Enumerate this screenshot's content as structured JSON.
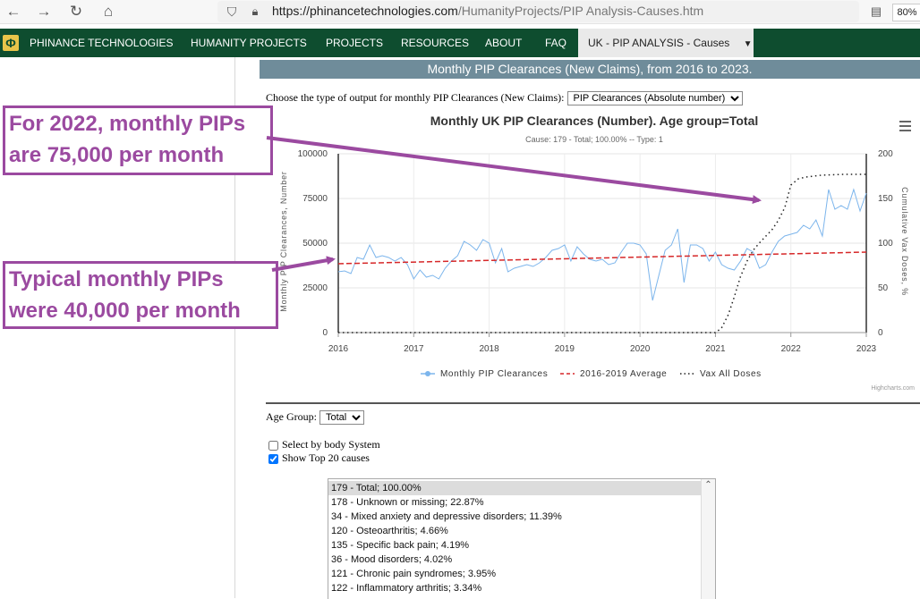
{
  "browser": {
    "url_host": "https://phinancetechnologies.com",
    "url_path": "/HumanityProjects/PIP Analysis-Causes.htm",
    "zoom": "80%"
  },
  "site_nav": {
    "logo": "Φ",
    "items": [
      "PHINANCE TECHNOLOGIES",
      "HUMANITY PROJECTS",
      "PROJECTS",
      "RESOURCES",
      "ABOUT",
      "FAQ"
    ],
    "active": "UK - PIP ANALYSIS - Causes"
  },
  "page": {
    "banner": "Monthly PIP Clearances (New Claims), from 2016 to 2023.",
    "output_label": "Choose the type of output for monthly PIP Clearances (New Claims):",
    "output_selected": "PIP Clearances (Absolute number)",
    "age_label": "Age Group:",
    "age_selected": "Total",
    "check_body": "Select by body System",
    "check_top20": "Show Top 20 causes",
    "causes": [
      "179 - Total; 100.00%",
      "178 - Unknown or missing; 22.87%",
      "34 - Mixed anxiety and depressive disorders; 11.39%",
      "120 - Osteoarthritis; 4.66%",
      "135 - Specific back pain; 4.19%",
      "36 - Mood disorders; 4.02%",
      "121 - Chronic pain syndromes; 3.95%",
      "122 - Inflammatory arthritis; 3.34%"
    ]
  },
  "annotations": {
    "callout_top_line1": "For 2022, monthly PIPs",
    "callout_top_line2": "are 75,000 per month",
    "callout_bottom_line1": "Typical monthly PIPs",
    "callout_bottom_line2": "were 40,000 per month"
  },
  "colors": {
    "nav": "#0e4d2f",
    "banner": "#6f8c9a",
    "callout": "#9b4aa0",
    "series": "#7cb5ec",
    "avg": "#d62728"
  },
  "chart_data": {
    "type": "line",
    "title": "Monthly UK PIP Clearances (Number). Age group=Total",
    "subtitle": "Cause: 179 - Total; 100.00% -- Type: 1",
    "ylabel": "Monthly PIP Clearances, Number",
    "y2label": "Cumulative Vax Doses, %",
    "credit": "Highcharts.com",
    "ylim": [
      0,
      100000
    ],
    "y2lim": [
      0,
      200
    ],
    "y_ticks": [
      "0",
      "25000",
      "50000",
      "75000",
      "100000"
    ],
    "y2_ticks": [
      "0",
      "50",
      "100",
      "150",
      "200"
    ],
    "x_ticks": [
      "2016",
      "2017",
      "2018",
      "2019",
      "2020",
      "2021",
      "2022",
      "2023"
    ],
    "x_range": [
      2016,
      2023
    ],
    "series": [
      {
        "name": "Monthly PIP Clearances",
        "x": [
          2016.0,
          2016.083,
          2016.167,
          2016.25,
          2016.333,
          2016.417,
          2016.5,
          2016.583,
          2016.667,
          2016.75,
          2016.833,
          2016.917,
          2017.0,
          2017.083,
          2017.167,
          2017.25,
          2017.333,
          2017.417,
          2017.5,
          2017.583,
          2017.667,
          2017.75,
          2017.833,
          2017.917,
          2018.0,
          2018.083,
          2018.167,
          2018.25,
          2018.333,
          2018.417,
          2018.5,
          2018.583,
          2018.667,
          2018.75,
          2018.833,
          2018.917,
          2019.0,
          2019.083,
          2019.167,
          2019.25,
          2019.333,
          2019.417,
          2019.5,
          2019.583,
          2019.667,
          2019.75,
          2019.833,
          2019.917,
          2020.0,
          2020.083,
          2020.167,
          2020.25,
          2020.333,
          2020.417,
          2020.5,
          2020.583,
          2020.667,
          2020.75,
          2020.833,
          2020.917,
          2021.0,
          2021.083,
          2021.167,
          2021.25,
          2021.333,
          2021.417,
          2021.5,
          2021.583,
          2021.667,
          2021.75,
          2021.833,
          2021.917,
          2022.0,
          2022.083,
          2022.167,
          2022.25,
          2022.333,
          2022.417,
          2022.5,
          2022.583,
          2022.667,
          2022.75,
          2022.833,
          2022.917,
          2023.0
        ],
        "values": [
          34000,
          34500,
          33000,
          42000,
          41000,
          49000,
          42000,
          43000,
          42000,
          40000,
          42000,
          38000,
          30000,
          35000,
          31000,
          32000,
          30000,
          36000,
          40000,
          43000,
          51000,
          49000,
          46000,
          52000,
          50000,
          39000,
          47000,
          34000,
          36000,
          37000,
          38000,
          37000,
          39000,
          42000,
          46000,
          47000,
          49000,
          40000,
          48000,
          44000,
          41000,
          40000,
          41000,
          38000,
          39000,
          45000,
          50000,
          50000,
          49000,
          44000,
          18000,
          32000,
          46000,
          49000,
          58000,
          28000,
          49000,
          49000,
          47000,
          40000,
          45000,
          38000,
          36000,
          35000,
          40000,
          47000,
          45000,
          36000,
          38000,
          45000,
          51000,
          54000,
          55000,
          56000,
          60000,
          58000,
          63000,
          54000,
          80000,
          69000,
          71000,
          69000,
          80000,
          68000,
          78000
        ],
        "color": "#7cb5ec"
      },
      {
        "name": "2016-2019 Average",
        "x": [
          2016,
          2023
        ],
        "values": [
          38500,
          45000
        ],
        "color": "#d62728"
      },
      {
        "name": "Vax All Doses",
        "axis": "y2",
        "x": [
          2016,
          2021.0,
          2021.08,
          2021.17,
          2021.25,
          2021.33,
          2021.42,
          2021.5,
          2021.58,
          2021.67,
          2021.75,
          2021.83,
          2021.92,
          2022.0,
          2022.1,
          2022.2,
          2022.4,
          2022.7,
          2023.0
        ],
        "values": [
          0,
          0,
          5,
          20,
          40,
          62,
          80,
          92,
          100,
          108,
          115,
          125,
          140,
          165,
          172,
          174,
          176,
          177,
          177
        ],
        "color": "#222222"
      }
    ]
  }
}
